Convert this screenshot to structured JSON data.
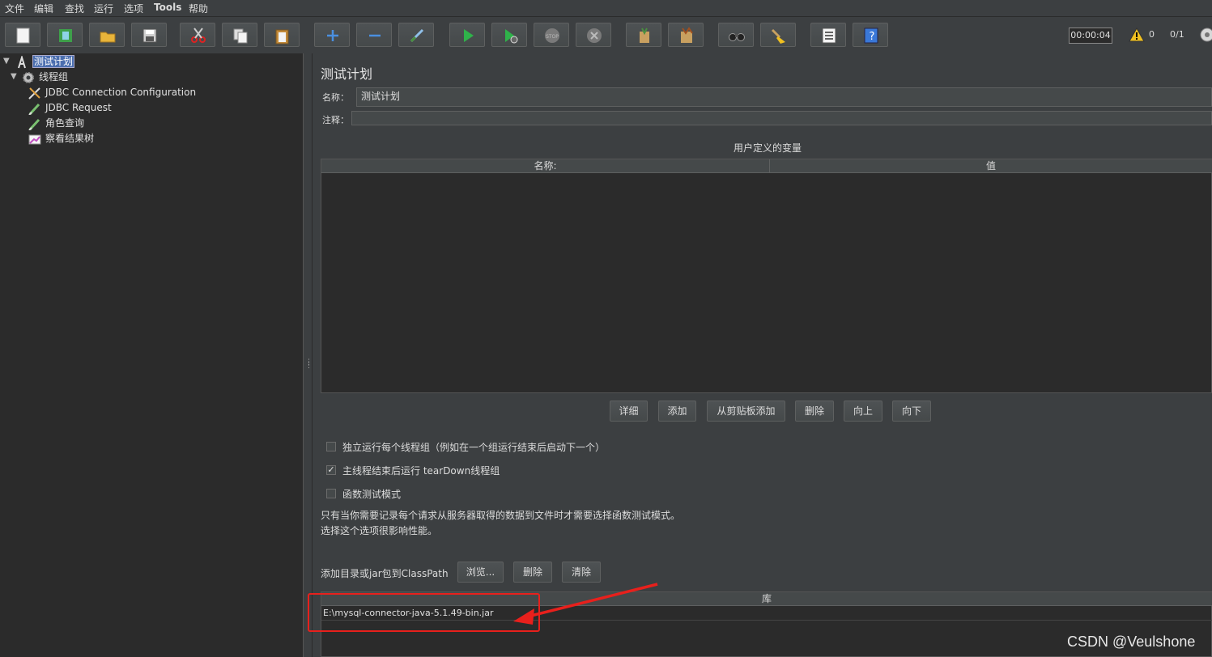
{
  "menu": [
    "文件",
    "编辑",
    "查找",
    "运行",
    "选项",
    "Tools",
    "帮助"
  ],
  "toolbar": {
    "buttons": [
      "new-icon",
      "templates-icon",
      "open-icon",
      "save-icon",
      "cut-icon",
      "copy-icon",
      "paste-icon",
      "expand-icon",
      "collapse-icon",
      "toggle-icon",
      "start-icon",
      "start-no-pause-icon",
      "stop-icon",
      "shutdown-icon",
      "clear-icon",
      "clear-all-icon",
      "search-icon",
      "reset-search-icon",
      "function-helper-icon",
      "help-icon"
    ],
    "timer": "00:00:04",
    "warning_count": "0",
    "threads": "0/1"
  },
  "tree": {
    "root": "测试计划",
    "thread_group": "线程组",
    "children": [
      "JDBC Connection Configuration",
      "JDBC Request",
      "角色查询",
      "察看结果树"
    ]
  },
  "panel": {
    "title": "测试计划",
    "name_label": "名称：",
    "name_value": "测试计划",
    "comment_label": "注释：",
    "comment_value": "",
    "vars_title": "用户定义的变量",
    "vars_columns": [
      "名称:",
      "值"
    ],
    "var_buttons": [
      "详细",
      "添加",
      "从剪贴板添加",
      "删除",
      "向上",
      "向下"
    ],
    "options": [
      {
        "label": "独立运行每个线程组（例如在一个组运行结束后启动下一个）",
        "checked": false
      },
      {
        "label": "主线程结束后运行 tearDown线程组",
        "checked": true
      },
      {
        "label": "函数测试模式",
        "checked": false
      }
    ],
    "note_lines": [
      "只有当你需要记录每个请求从服务器取得的数据到文件时才需要选择函数测试模式。",
      "选择这个选项很影响性能。"
    ],
    "classpath_label": "添加目录或jar包到ClassPath",
    "classpath_buttons": [
      "浏览...",
      "删除",
      "清除"
    ],
    "library_header": "库",
    "library_items": [
      "E:\\mysql-connector-java-5.1.49-bin.jar"
    ]
  },
  "watermark": "CSDN @Veulshone",
  "colors": {
    "annotation": "#e8201c",
    "selection": "#4b6eaf"
  }
}
